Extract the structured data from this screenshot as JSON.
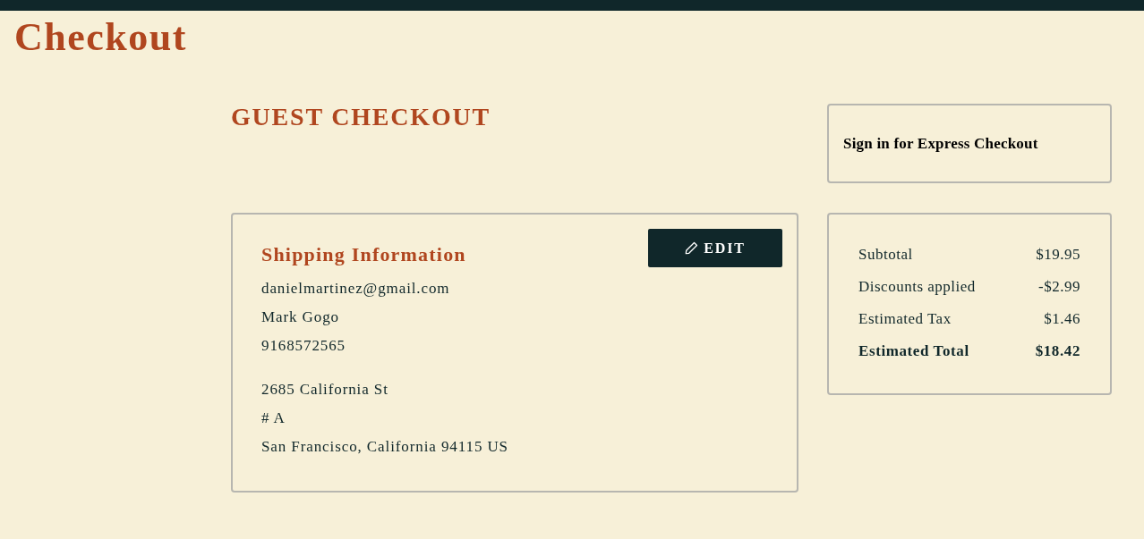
{
  "page_title": "Checkout",
  "section_heading": "GUEST CHECKOUT",
  "express_signin": {
    "label": "Sign in for Express Checkout"
  },
  "shipping": {
    "title": "Shipping Information",
    "edit_button": "EDIT",
    "contact": [
      "danielmartinez@gmail.com",
      "Mark Gogo",
      "9168572565"
    ],
    "address": [
      "2685 California St",
      "# A",
      "San Francisco, California 94115 US"
    ]
  },
  "summary": {
    "rows": [
      {
        "label": "Subtotal",
        "value": "$19.95",
        "kind": "line"
      },
      {
        "label": "Discounts applied",
        "value": "-$2.99",
        "kind": "line"
      },
      {
        "label": "Estimated Tax",
        "value": "$1.46",
        "kind": "line"
      },
      {
        "label": "Estimated Total",
        "value": "$18.42",
        "kind": "total"
      }
    ]
  }
}
